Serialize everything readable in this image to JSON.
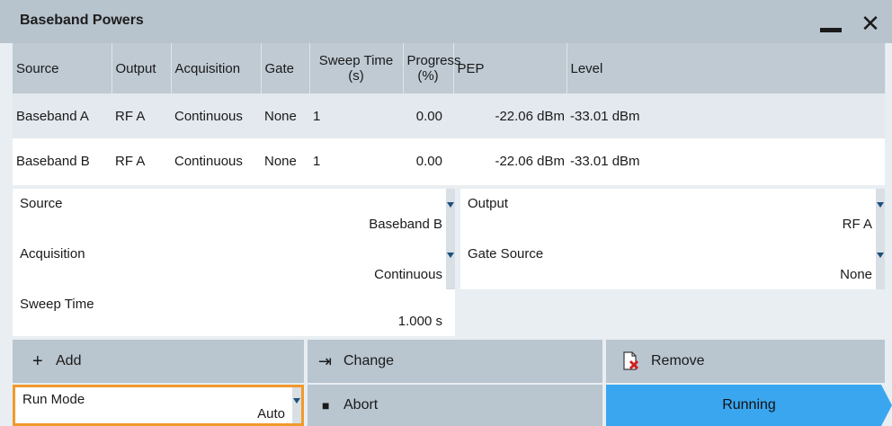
{
  "window": {
    "title": "Baseband Powers",
    "minimize_icon": "minimize-icon",
    "close_icon": "close-icon",
    "close_glyph": "✕"
  },
  "table": {
    "headers": [
      "Source",
      "Output",
      "Acquisition",
      "Gate",
      "Sweep Time (s)",
      "Progress (%)",
      "PEP",
      "Level"
    ],
    "header_lines": {
      "sweep": [
        "Sweep Time",
        "(s)"
      ],
      "progress": [
        "Progress",
        "(%)"
      ]
    },
    "rows": [
      {
        "source": "Baseband A",
        "output": "RF A",
        "acquisition": "Continuous",
        "gate": "None",
        "sweep_time": "1",
        "progress": "0.00",
        "pep": "-22.06 dBm",
        "level": "-33.01 dBm"
      },
      {
        "source": "Baseband B",
        "output": "RF A",
        "acquisition": "Continuous",
        "gate": "None",
        "sweep_time": "1",
        "progress": "0.00",
        "pep": "-22.06 dBm",
        "level": "-33.01 dBm"
      }
    ]
  },
  "form": {
    "source": {
      "label": "Source",
      "value": "Baseband B"
    },
    "output": {
      "label": "Output",
      "value": "RF A"
    },
    "acquisition": {
      "label": "Acquisition",
      "value": "Continuous"
    },
    "gate_source": {
      "label": "Gate Source",
      "value": "None"
    },
    "sweep_time": {
      "label": "Sweep Time",
      "value": "1.000 s"
    }
  },
  "buttons": {
    "add": {
      "label": "Add",
      "icon": "plus-icon",
      "glyph": "+"
    },
    "change": {
      "label": "Change",
      "icon": "arrow-to-bar-icon",
      "glyph": "⇥"
    },
    "remove": {
      "label": "Remove",
      "icon": "remove-document-icon"
    },
    "abort": {
      "label": "Abort",
      "icon": "stop-icon",
      "glyph": "■"
    }
  },
  "run_mode": {
    "label": "Run Mode",
    "value": "Auto"
  },
  "status": {
    "label": "Running"
  },
  "colors": {
    "titlebar": "#b7c3cd",
    "button": "#b9c5cf",
    "focus_orange": "#f09a2a",
    "running_blue": "#3aa6ef",
    "remove_x_red": "#d11f1f"
  }
}
